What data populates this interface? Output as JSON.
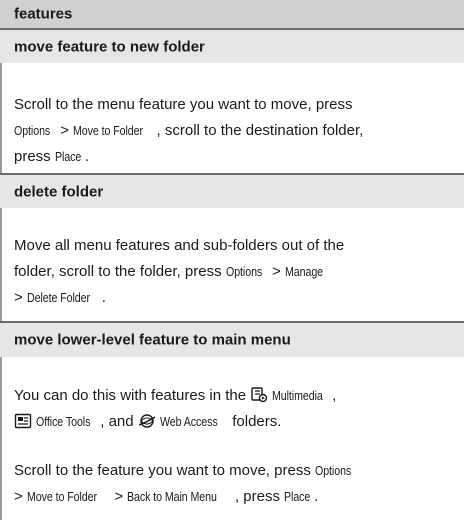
{
  "title": "features",
  "sections": [
    {
      "heading": "move feature to new folder",
      "p1_text1": "Scroll to the menu feature you want to move, press",
      "p1_options": "Options",
      "p1_gt1": " > ",
      "p1_move": "Move to Folder",
      "p1_text2": ", scroll to the destination folder,",
      "p1_text3": "press ",
      "p1_place": "Place",
      "p1_text4": "."
    },
    {
      "heading": "delete folder",
      "p1_text1": "Move all menu features and sub-folders out of the",
      "p1_text2": "folder, scroll to the folder, press ",
      "p1_options": "Options",
      "p1_gt1": " > ",
      "p1_manage": "Manage",
      "p1_gt2": "> ",
      "p1_delete": "Delete Folder",
      "p1_text3": "."
    },
    {
      "heading": "move lower-level feature to main menu",
      "p1_text1": "You can do this with features in the ",
      "p1_multimedia": "Multimedia",
      "p1_comma": ",",
      "p1_office": "Office Tools",
      "p1_text2": ", and ",
      "p1_web": "Web Access",
      "p1_text3": " folders.",
      "p2_text1": "Scroll to the feature you want to move, press ",
      "p2_options": "Options",
      "p2_gt1": "> ",
      "p2_move": "Move to Folder",
      "p2_gt2": " > ",
      "p2_back": "Back to Main Menu",
      "p2_text2": ", press ",
      "p2_place": "Place",
      "p2_text3": "."
    }
  ],
  "icons": {
    "multimedia": "multimedia-icon",
    "office": "office-tools-icon",
    "web": "web-access-icon"
  }
}
